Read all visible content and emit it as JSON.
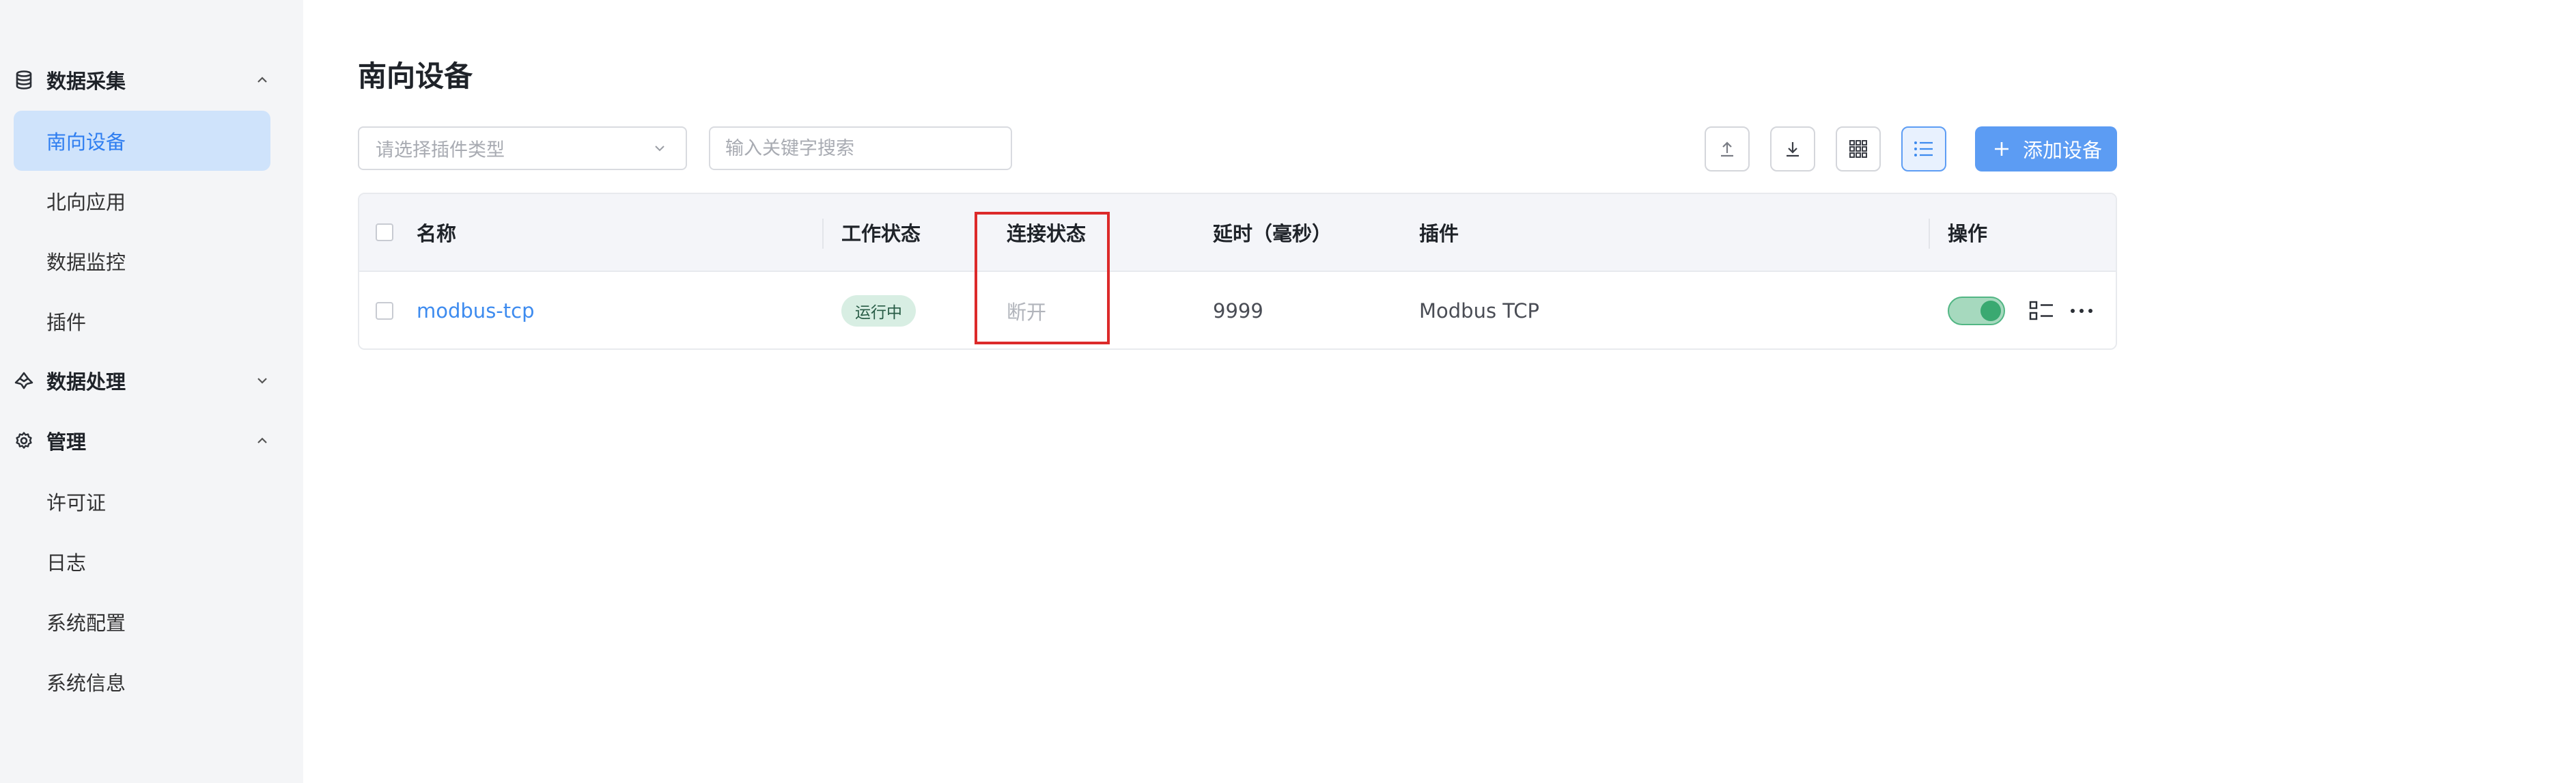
{
  "sidebar": {
    "groups": [
      {
        "label": "数据采集",
        "icon": "database-icon",
        "expanded": true,
        "items": [
          {
            "label": "南向设备",
            "active": true
          },
          {
            "label": "北向应用",
            "active": false
          },
          {
            "label": "数据监控",
            "active": false
          },
          {
            "label": "插件",
            "active": false
          }
        ]
      },
      {
        "label": "数据处理",
        "icon": "data-processing-icon",
        "expanded": false,
        "items": []
      },
      {
        "label": "管理",
        "icon": "gear-icon",
        "expanded": true,
        "items": [
          {
            "label": "许可证",
            "active": false
          },
          {
            "label": "日志",
            "active": false
          },
          {
            "label": "系统配置",
            "active": false
          },
          {
            "label": "系统信息",
            "active": false
          }
        ]
      }
    ]
  },
  "page": {
    "title": "南向设备"
  },
  "toolbar": {
    "plugin_select_placeholder": "请选择插件类型",
    "search_placeholder": "输入关键字搜索",
    "buttons": [
      {
        "name": "import-button",
        "icon": "upload-icon"
      },
      {
        "name": "export-button",
        "icon": "download-icon"
      },
      {
        "name": "card-view-button",
        "icon": "grid-icon"
      },
      {
        "name": "list-view-button",
        "icon": "list-icon",
        "active": true
      }
    ],
    "add_label": "添加设备"
  },
  "table": {
    "columns": [
      "名称",
      "工作状态",
      "连接状态",
      "延时（毫秒）",
      "插件",
      "操作"
    ],
    "rows": [
      {
        "name": "modbus-tcp",
        "work_status": "运行中",
        "connection_status": "断开",
        "delay": "9999",
        "plugin": "Modbus TCP",
        "enabled": true
      }
    ]
  },
  "colors": {
    "accent": "#5c9cf3",
    "active_item_bg": "#cfe3fb",
    "link": "#3d8bef",
    "running_badge_bg": "#d8eee3",
    "toggle_on": "#3aa971",
    "highlight": "#dc2a2a"
  }
}
